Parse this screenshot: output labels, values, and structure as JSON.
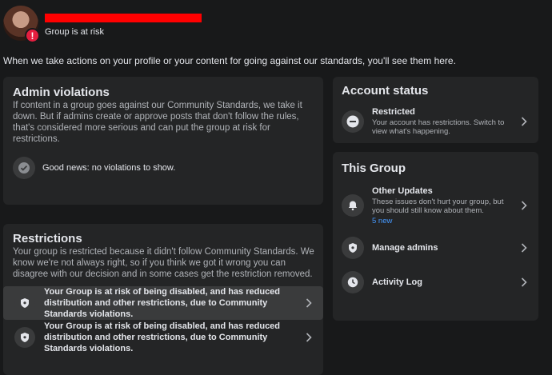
{
  "header": {
    "group_status": "Group is at risk",
    "alert_symbol": "!"
  },
  "intro_text": "When we take actions on your profile or your content for going against our standards, you'll see them here.",
  "admin_violations": {
    "title": "Admin violations",
    "description": "If content in a group goes against our Community Standards, we take it down. But if admins create or approve posts that don't follow the rules, that's considered more serious and can put the group at risk for restrictions.",
    "good_news": "Good news: no violations to show."
  },
  "restrictions": {
    "title": "Restrictions",
    "description": "Your group is restricted because it didn't follow Community Standards. We know we're not always right, so if you think we got it wrong you can disagree with our decision and in some cases get the restriction removed.",
    "items": [
      {
        "text": "Your Group is at risk of being disabled, and has reduced distribution and other restrictions, due to Community Standards violations."
      },
      {
        "text": "Your Group is at risk of being disabled, and has reduced distribution and other restrictions, due to Community Standards violations."
      }
    ]
  },
  "account_status": {
    "title": "Account status",
    "row_title": "Restricted",
    "row_subtitle": "Your account has restrictions. Switch to view what's happening."
  },
  "this_group": {
    "title": "This Group",
    "other_updates": {
      "title": "Other Updates",
      "subtitle": "These issues don't hurt your group, but you should still know about them.",
      "new_count": "5 new"
    },
    "manage_admins": "Manage admins",
    "activity_log": "Activity Log"
  },
  "colors": {
    "background": "#18191a",
    "card": "#242526",
    "alert_red": "#e41e3f",
    "link_blue": "#4599ff"
  },
  "icons": [
    "alert-icon",
    "check-icon",
    "shield-icon",
    "minus-icon",
    "bell-icon",
    "clock-icon",
    "chevron-right-icon"
  ]
}
